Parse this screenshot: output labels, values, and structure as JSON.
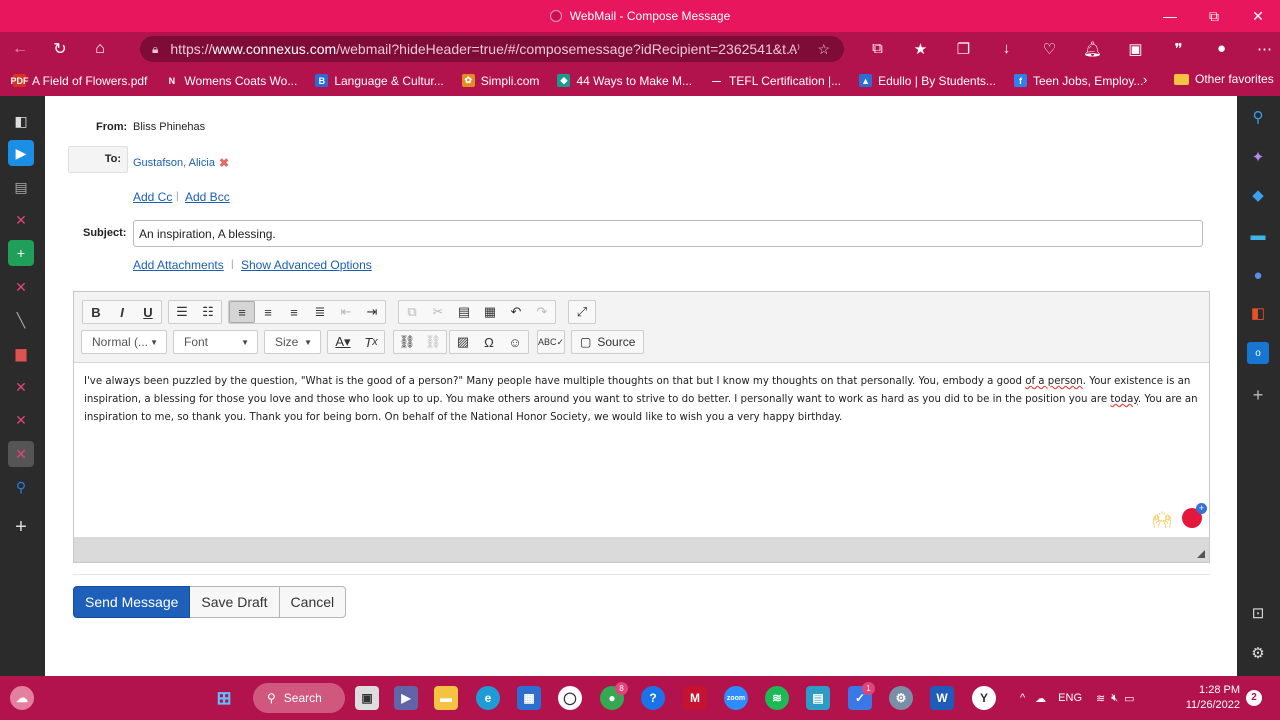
{
  "window": {
    "title": "WebMail - Compose Message",
    "minimize": "—",
    "maximize": "⧉",
    "close": "✕"
  },
  "browser": {
    "url_scheme": "https://",
    "url_host": "www.connexus.com",
    "url_rest": "/webmail?hideHeader=true/#/composemessage?idRecipient=2362541&t...",
    "read_aloud": "A⁾",
    "favorites_bar": [
      {
        "label": "A Field of Flowers.pdf",
        "icon_text": "PDF",
        "color": "#d9311f"
      },
      {
        "label": "Womens Coats Wo...",
        "icon_text": "N",
        "color": "#b3134c"
      },
      {
        "label": "Language & Cultur...",
        "icon_text": "B",
        "color": "#2a6bd6"
      },
      {
        "label": "Simpli.com",
        "icon_text": "✿",
        "color": "#e58b22"
      },
      {
        "label": "44 Ways to Make M...",
        "icon_text": "◆",
        "color": "#1a9b8f"
      },
      {
        "label": "TEFL Certification |...",
        "icon_text": "—",
        "color": "#b3134c"
      },
      {
        "label": "Edullo | By Students...",
        "icon_text": "▲",
        "color": "#2d6fd1"
      },
      {
        "label": "Teen Jobs, Employ...",
        "icon_text": "f",
        "color": "#2f80ed"
      }
    ],
    "other_favorites": "Other favorites"
  },
  "compose": {
    "from_label": "From:",
    "from_value": "Bliss Phinehas",
    "to_label": "To:",
    "recipient": "Gustafson, Alicia",
    "remove_icon": "✖",
    "add_cc": "Add Cc",
    "add_bcc": "Add Bcc",
    "link_separator": "|",
    "subject_label": "Subject:",
    "subject_value": "An inspiration, A blessing.",
    "add_attachments": "Add Attachments",
    "show_advanced": "Show Advanced Options"
  },
  "editor": {
    "format_combo": "Normal (...",
    "font_combo": "Font",
    "size_combo": "Size",
    "source_label": "Source",
    "body_part1": " I've always been puzzled by the question, \"What is the good of a person?\" Many people have multiple thoughts on that but I know my thoughts on that personally. You, embody a good ",
    "body_misspell1": "of a person",
    "body_part2": ". Your existence is an inspiration, a blessing for those you love and those who look up to up. You make others around you want to strive to do better. I personally want to work as hard as you did to be in the position you are ",
    "body_misspell2": "today",
    "body_part3": ". You are an inspiration to me, so thank you. Thank you for being born. On behalf of the National Honor Society, we would like to wish you a very happy birthday."
  },
  "actions": {
    "send": "Send Message",
    "save_draft": "Save Draft",
    "cancel": "Cancel"
  },
  "taskbar": {
    "search_label": "Search",
    "language": "ENG",
    "time": "1:28 PM",
    "date": "11/26/2022",
    "notifications": "2",
    "badge_chrome": "8",
    "badge_tasks": "1"
  },
  "colors": {
    "titlebar": "#e8175d",
    "browser_chrome": "#b3134c",
    "primary_button": "#1d5fb9",
    "link": "#1a5fb4"
  }
}
